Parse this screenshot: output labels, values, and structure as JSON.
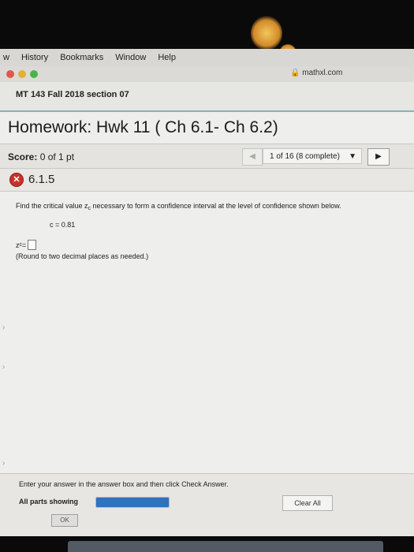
{
  "menu": [
    "w",
    "History",
    "Bookmarks",
    "Window",
    "Help"
  ],
  "browser": {
    "url": "mathxl.com",
    "lock_icon": "lock-icon"
  },
  "course": {
    "title": "MT 143 Fall 2018 section 07"
  },
  "homework": {
    "title": "Homework: Hwk 11 ( Ch 6.1- Ch 6.2)"
  },
  "score": {
    "label": "Score:",
    "value": "0 of 1 pt"
  },
  "navigation": {
    "prev_icon": "triangle-left-icon",
    "question_select": "1 of 16 (8 complete)",
    "next_icon": "triangle-right-icon"
  },
  "question": {
    "status_icon": "x-circle-icon",
    "number": "6.1.5",
    "prompt_pre": "Find the critical value z",
    "prompt_sub": "c",
    "prompt_post": " necessary to form a confidence interval at the level of confidence shown below.",
    "c_value": "c = 0.81",
    "answer_label_main": "z",
    "answer_label_sub": "c",
    "answer_label_eq": " =",
    "hint": "(Round to two decimal places as needed.)"
  },
  "footer": {
    "instruction": "Enter your answer in the answer box and then click Check Answer.",
    "parts_label": "All parts showing",
    "parts_progress": 1.0,
    "clear_label": "Clear All",
    "ok_label": "OK"
  },
  "colors": {
    "page_bg": "#eeeeec",
    "accent_border": "#8ab0b3",
    "progress": "#2f72c0",
    "wrong_icon": "#c8332d"
  }
}
